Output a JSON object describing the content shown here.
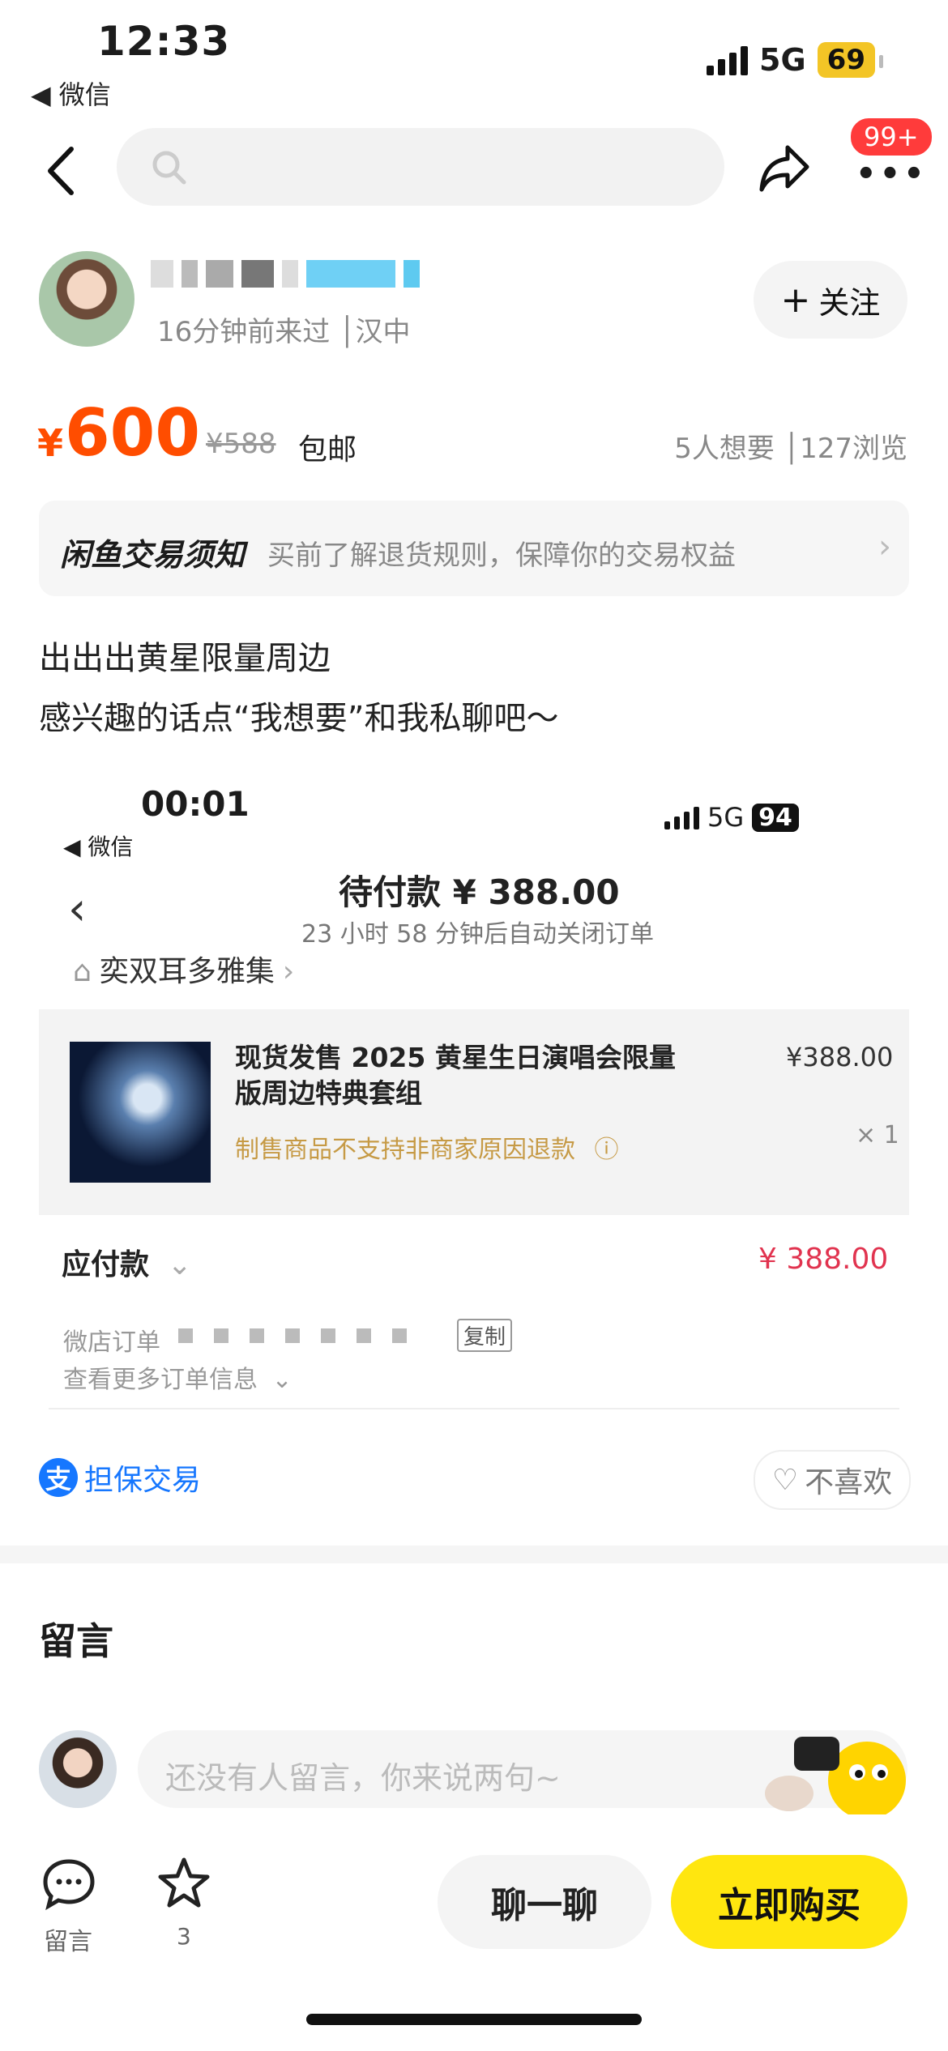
{
  "status_bar": {
    "time": "12:33",
    "back_app": "◀ 微信",
    "network": "5G",
    "battery": "69"
  },
  "nav": {
    "more_badge": "99+"
  },
  "seller": {
    "visit_info": "16分钟前来过 │汉中",
    "follow_label": "关注"
  },
  "price": {
    "currency": "¥",
    "current": "600",
    "original": "¥588",
    "shipping": "包邮",
    "stats": "5人想要 │127浏览"
  },
  "notice": {
    "title": "闲鱼交易须知",
    "desc": "买前了解退货规则，保障你的交易权益"
  },
  "description": {
    "line1": "出出出黄星限量周边",
    "line2": "感兴趣的话点“我想要”和我私聊吧～"
  },
  "embedded_screenshot": {
    "time": "00:01",
    "back_app": "◀ 微信",
    "network": "5G",
    "battery": "94",
    "title": "待付款 ¥ 388.00",
    "subtitle": "23 小时 58 分钟后自动关闭订单",
    "store": "奕双耳多雅集",
    "product": "现货发售 2025 黄星生日演唱会限量版周边特典套组",
    "warning": "制售商品不支持非商家原因退款",
    "unit_price": "¥388.00",
    "qty": "× 1",
    "pay_label": "应付款",
    "pay_value": "¥ 388.00",
    "order_label": "微店订单",
    "copy_label": "复制",
    "more_info": "查看更多订单信息"
  },
  "guarantee_label": "担保交易",
  "dislike_label": "不喜欢",
  "comments": {
    "title": "留言",
    "placeholder": "还没有人留言，你来说两句~"
  },
  "bottom_bar": {
    "msg_label": "留言",
    "fav_count": "3",
    "chat_label": "聊一聊",
    "buy_label": "立即购买"
  }
}
